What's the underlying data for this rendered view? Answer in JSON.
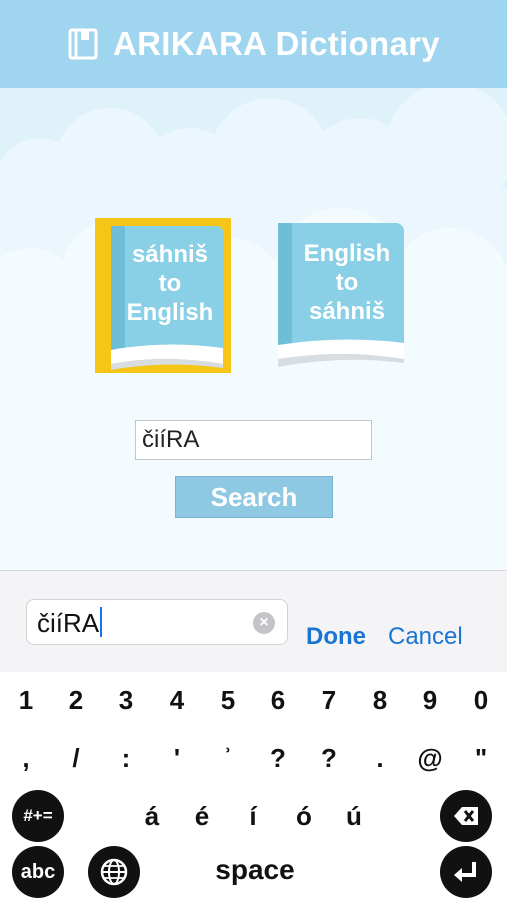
{
  "app": {
    "title": "ARIKARA Dictionary"
  },
  "books": [
    {
      "lines": [
        "sáhniš",
        "to",
        "English"
      ],
      "selected": true
    },
    {
      "lines": [
        "English",
        "to",
        "sáhniš"
      ],
      "selected": false
    }
  ],
  "search": {
    "value": "čiíRA",
    "button_label": "Search"
  },
  "searchbar": {
    "value": "čiíRA",
    "clear_icon": "clear-icon",
    "done_label": "Done",
    "cancel_label": "Cancel"
  },
  "keyboard": {
    "row1": [
      "1",
      "2",
      "3",
      "4",
      "5",
      "6",
      "7",
      "8",
      "9",
      "0"
    ],
    "row2": [
      ",",
      "/",
      ":",
      "'",
      "ʾ",
      "?",
      "?",
      ".",
      "@",
      "\""
    ],
    "row3_mode": "#+=",
    "row3": [
      "á",
      "é",
      "í",
      "ó",
      "ú"
    ],
    "row4_abc": "abc",
    "space_label": "space"
  },
  "colors": {
    "header": "#9fd5ee",
    "accent": "#1a74d2",
    "selection": "#f5c518",
    "button": "#8fc8e2"
  }
}
